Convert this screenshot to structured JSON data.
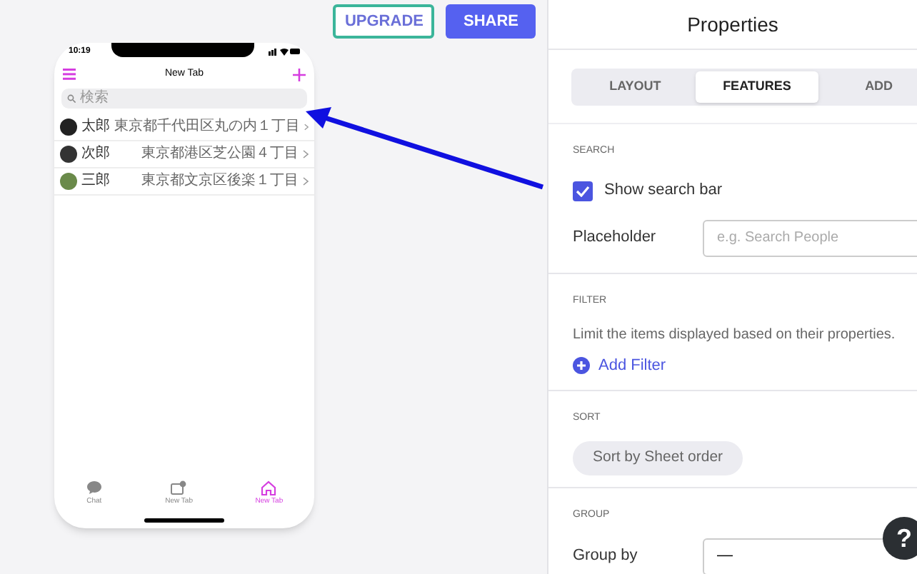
{
  "toolbar": {
    "buttons": [
      {
        "label": "UPGRADE",
        "kind": "outline"
      },
      {
        "label": "SHARE",
        "kind": "solid"
      }
    ]
  },
  "phone": {
    "status_time": "10:19",
    "title": "New Tab",
    "search": {
      "placeholder": "検索"
    },
    "rows": [
      {
        "name": "太郎",
        "address": "東京都千代田区丸の内１丁目"
      },
      {
        "name": "次郎",
        "address": "東京都港区芝公園４丁目"
      },
      {
        "name": "三郎",
        "address": "東京都文京区後楽１丁目"
      }
    ],
    "tab_bar": [
      {
        "label": "Chat",
        "kind": "chat",
        "selected": false
      },
      {
        "label": "New Tab",
        "kind": "tab",
        "selected": false
      },
      {
        "label": "New Tab",
        "kind": "home",
        "selected": true
      }
    ]
  },
  "properties": {
    "title": "Properties",
    "tabs": [
      {
        "label": "LAYOUT",
        "selected": false
      },
      {
        "label": "FEATURES",
        "selected": true
      },
      {
        "label": "ADD",
        "selected": false
      }
    ],
    "sections": [
      {
        "heading": "SEARCH",
        "items": [
          {
            "kind": "checkbox",
            "label": "Show search bar",
            "checked": true
          },
          {
            "kind": "field",
            "label": "Placeholder",
            "placeholder": "e.g. Search People"
          }
        ]
      },
      {
        "heading": "FILTER",
        "items": [
          {
            "kind": "text",
            "text": "Limit the items displayed based on their properties."
          },
          {
            "kind": "link",
            "label": "Add Filter"
          }
        ]
      },
      {
        "heading": "SORT",
        "items": [
          {
            "kind": "pill",
            "label": "Sort by Sheet order"
          }
        ]
      },
      {
        "heading": "GROUP",
        "items": [
          {
            "kind": "select",
            "label": "Group by",
            "value": "—"
          }
        ]
      }
    ]
  },
  "help": {
    "label": "?"
  }
}
